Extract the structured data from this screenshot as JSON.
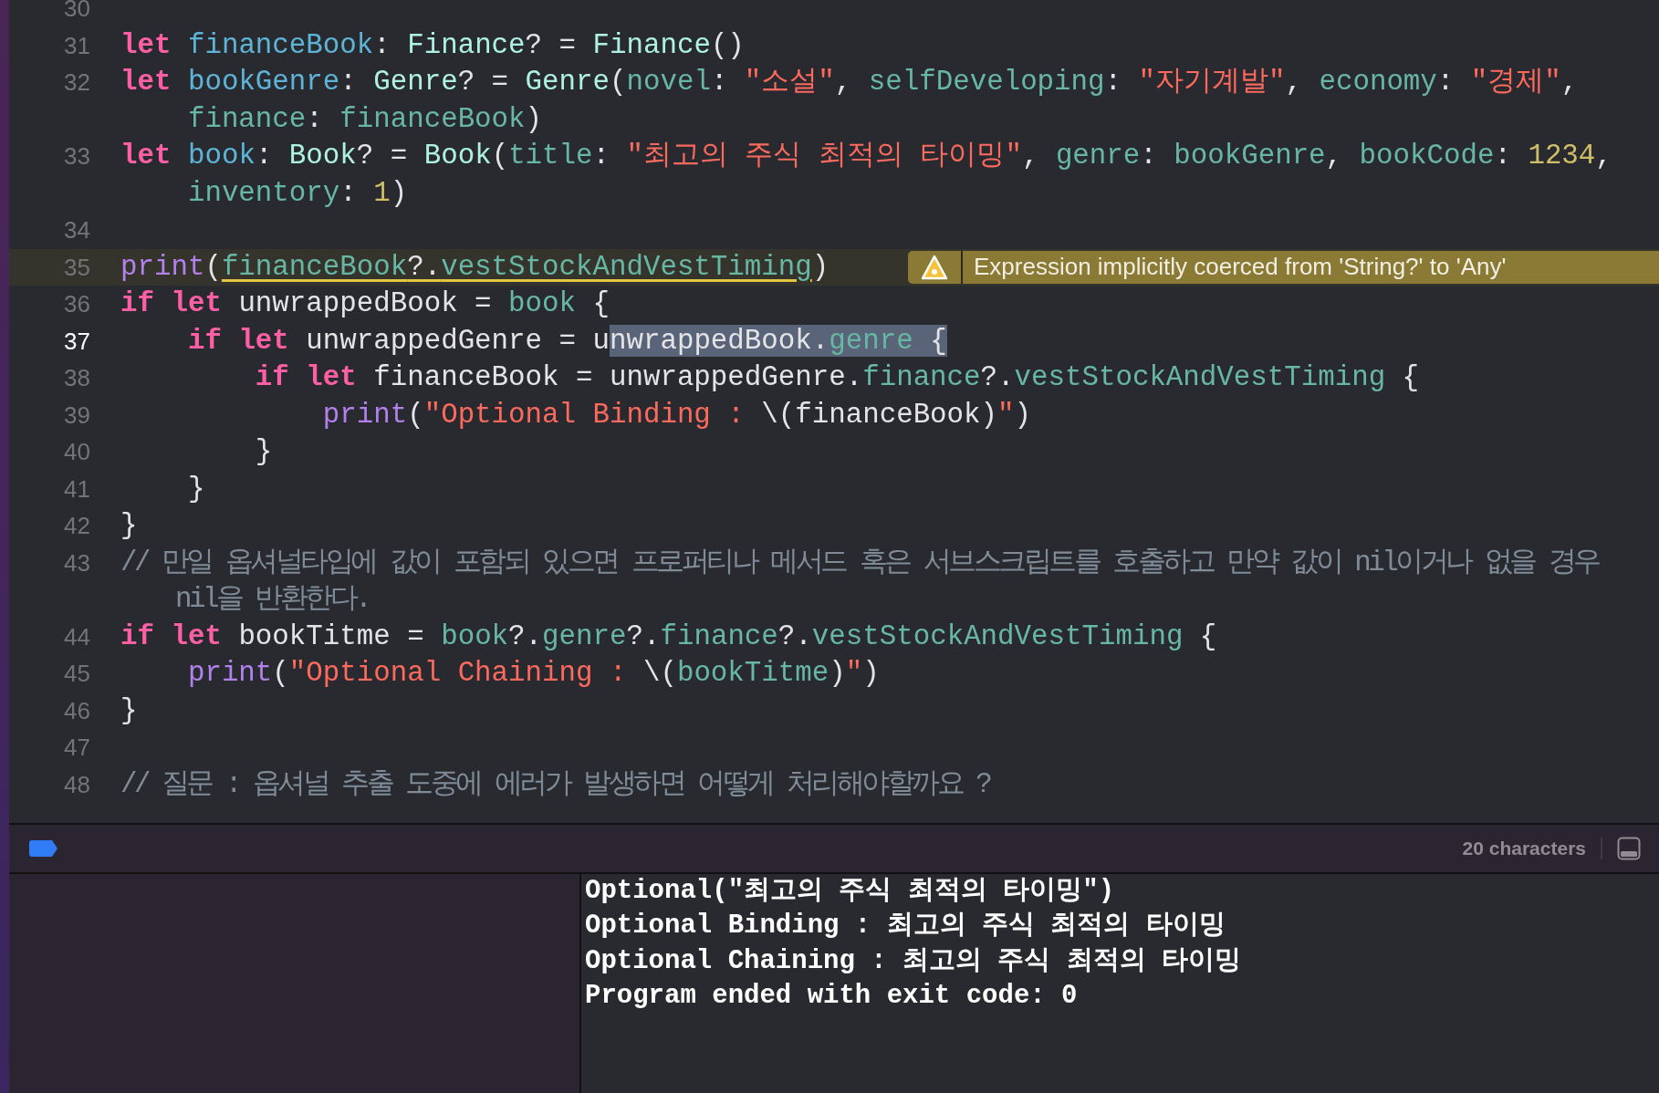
{
  "editor": {
    "lines": [
      {
        "number": "30",
        "active": false
      },
      {
        "number": "31",
        "active": false,
        "tokens": [
          {
            "text": "let ",
            "kind": "keyword"
          },
          {
            "text": "financeBook",
            "kind": "decl"
          },
          {
            "text": ": ",
            "kind": "plain"
          },
          {
            "text": "Finance",
            "kind": "type"
          },
          {
            "text": "? = ",
            "kind": "plain"
          },
          {
            "text": "Finance",
            "kind": "type"
          },
          {
            "text": "()",
            "kind": "plain"
          }
        ]
      },
      {
        "number": "32",
        "active": false,
        "tokens": [
          {
            "text": "let ",
            "kind": "keyword"
          },
          {
            "text": "bookGenre",
            "kind": "decl"
          },
          {
            "text": ": ",
            "kind": "plain"
          },
          {
            "text": "Genre",
            "kind": "type"
          },
          {
            "text": "? = ",
            "kind": "plain"
          },
          {
            "text": "Genre",
            "kind": "type"
          },
          {
            "text": "(",
            "kind": "plain"
          },
          {
            "text": "novel",
            "kind": "member"
          },
          {
            "text": ": ",
            "kind": "plain"
          },
          {
            "text": "\"소설\"",
            "kind": "string"
          },
          {
            "text": ", ",
            "kind": "plain"
          },
          {
            "text": "selfDeveloping",
            "kind": "member"
          },
          {
            "text": ": ",
            "kind": "plain"
          },
          {
            "text": "\"자기계발\"",
            "kind": "string"
          },
          {
            "text": ", ",
            "kind": "plain"
          },
          {
            "text": "economy",
            "kind": "member"
          },
          {
            "text": ": ",
            "kind": "plain"
          },
          {
            "text": "\"경제\"",
            "kind": "string"
          },
          {
            "text": ",",
            "kind": "plain"
          }
        ],
        "continuation": [
          {
            "text": "    finance",
            "kind": "member"
          },
          {
            "text": ": ",
            "kind": "plain"
          },
          {
            "text": "financeBook",
            "kind": "member"
          },
          {
            "text": ")",
            "kind": "plain"
          }
        ]
      },
      {
        "number": "33",
        "active": false,
        "tokens": [
          {
            "text": "let ",
            "kind": "keyword"
          },
          {
            "text": "book",
            "kind": "decl"
          },
          {
            "text": ": ",
            "kind": "plain"
          },
          {
            "text": "Book",
            "kind": "type"
          },
          {
            "text": "? = ",
            "kind": "plain"
          },
          {
            "text": "Book",
            "kind": "type"
          },
          {
            "text": "(",
            "kind": "plain"
          },
          {
            "text": "title",
            "kind": "member"
          },
          {
            "text": ": ",
            "kind": "plain"
          },
          {
            "text": "\"최고의 주식 최적의 타이밍\"",
            "kind": "string"
          },
          {
            "text": ", ",
            "kind": "plain"
          },
          {
            "text": "genre",
            "kind": "member"
          },
          {
            "text": ": ",
            "kind": "plain"
          },
          {
            "text": "bookGenre",
            "kind": "member"
          },
          {
            "text": ", ",
            "kind": "plain"
          },
          {
            "text": "bookCode",
            "kind": "member"
          },
          {
            "text": ": ",
            "kind": "plain"
          },
          {
            "text": "1234",
            "kind": "number"
          },
          {
            "text": ",",
            "kind": "plain"
          }
        ],
        "continuation": [
          {
            "text": "    inventory",
            "kind": "member"
          },
          {
            "text": ": ",
            "kind": "plain"
          },
          {
            "text": "1",
            "kind": "number"
          },
          {
            "text": ")",
            "kind": "plain"
          }
        ]
      },
      {
        "number": "34",
        "active": false
      },
      {
        "number": "35",
        "active": false,
        "warning": "Expression implicitly coerced from 'String?' to 'Any'",
        "tokens": [
          {
            "text": "print",
            "kind": "function"
          },
          {
            "text": "(",
            "kind": "plain"
          },
          {
            "text": "financeBook",
            "kind": "member",
            "underlined": true
          },
          {
            "text": "?.",
            "kind": "plain",
            "underlined": true
          },
          {
            "text": "vestStockAndVestTiming",
            "kind": "member",
            "underlined": true
          },
          {
            "text": ")",
            "kind": "plain"
          }
        ]
      },
      {
        "number": "36",
        "active": false,
        "tokens": [
          {
            "text": "if ",
            "kind": "keyword"
          },
          {
            "text": "let",
            "kind": "keyword"
          },
          {
            "text": " unwrappedBook = ",
            "kind": "plain"
          },
          {
            "text": "book",
            "kind": "member"
          },
          {
            "text": " {",
            "kind": "plain"
          }
        ]
      },
      {
        "number": "37",
        "active": true,
        "tokens": [
          {
            "text": "    if ",
            "kind": "keyword"
          },
          {
            "text": "let",
            "kind": "keyword"
          },
          {
            "text": " unwrappedGenre = u",
            "kind": "plain"
          },
          {
            "text": "nwrappedBook.",
            "kind": "plain",
            "selected": true
          },
          {
            "text": "genre",
            "kind": "member",
            "selected": true
          },
          {
            "text": " {",
            "kind": "plain",
            "selected": true
          }
        ]
      },
      {
        "number": "38",
        "active": false,
        "tokens": [
          {
            "text": "        if ",
            "kind": "keyword"
          },
          {
            "text": "let",
            "kind": "keyword"
          },
          {
            "text": " financeBook = unwrappedGenre.",
            "kind": "plain"
          },
          {
            "text": "finance",
            "kind": "member"
          },
          {
            "text": "?.",
            "kind": "plain"
          },
          {
            "text": "vestStockAndVestTiming",
            "kind": "member"
          },
          {
            "text": " {",
            "kind": "plain"
          }
        ]
      },
      {
        "number": "39",
        "active": false,
        "tokens": [
          {
            "text": "            print",
            "kind": "function"
          },
          {
            "text": "(",
            "kind": "plain"
          },
          {
            "text": "\"Optional Binding : ",
            "kind": "string"
          },
          {
            "text": "\\(financeBook)",
            "kind": "plain"
          },
          {
            "text": "\"",
            "kind": "string"
          },
          {
            "text": ")",
            "kind": "plain"
          }
        ]
      },
      {
        "number": "40",
        "active": false,
        "tokens": [
          {
            "text": "        }",
            "kind": "plain"
          }
        ]
      },
      {
        "number": "41",
        "active": false,
        "tokens": [
          {
            "text": "    }",
            "kind": "plain"
          }
        ]
      },
      {
        "number": "42",
        "active": false,
        "tokens": [
          {
            "text": "}",
            "kind": "plain"
          }
        ]
      },
      {
        "number": "43",
        "active": false,
        "tokens": [
          {
            "text": "// 만일 옵셔널타입에 값이 포함되 있으면 프로퍼티나 메서드 혹은 서브스크립트를 호출하고 만약 값이 nil이거나 없을 경우",
            "kind": "comment"
          }
        ],
        "continuation": [
          {
            "text": "    nil을 반환한다.",
            "kind": "comment"
          }
        ]
      },
      {
        "number": "44",
        "active": false,
        "tokens": [
          {
            "text": "if ",
            "kind": "keyword"
          },
          {
            "text": "let",
            "kind": "keyword"
          },
          {
            "text": " bookTitme = ",
            "kind": "plain"
          },
          {
            "text": "book",
            "kind": "member"
          },
          {
            "text": "?.",
            "kind": "plain"
          },
          {
            "text": "genre",
            "kind": "member"
          },
          {
            "text": "?.",
            "kind": "plain"
          },
          {
            "text": "finance",
            "kind": "member"
          },
          {
            "text": "?.",
            "kind": "plain"
          },
          {
            "text": "vestStockAndVestTiming",
            "kind": "member"
          },
          {
            "text": " {",
            "kind": "plain"
          }
        ]
      },
      {
        "number": "45",
        "active": false,
        "tokens": [
          {
            "text": "    print",
            "kind": "function"
          },
          {
            "text": "(",
            "kind": "plain"
          },
          {
            "text": "\"Optional Chaining : ",
            "kind": "string"
          },
          {
            "text": "\\(",
            "kind": "plain"
          },
          {
            "text": "bookTitme",
            "kind": "member"
          },
          {
            "text": ")",
            "kind": "plain"
          },
          {
            "text": "\"",
            "kind": "string"
          },
          {
            "text": ")",
            "kind": "plain"
          }
        ]
      },
      {
        "number": "46",
        "active": false,
        "tokens": [
          {
            "text": "}",
            "kind": "plain"
          }
        ]
      },
      {
        "number": "47",
        "active": false
      },
      {
        "number": "48",
        "active": false,
        "tokens": [
          {
            "text": "// 질문 : 옵셔널 추출 도중에 에러가 발생하면 어떻게 처리해야할까요 ?",
            "kind": "comment"
          }
        ]
      }
    ]
  },
  "debug_bar": {
    "selection_count": "20 characters"
  },
  "console": {
    "output": [
      "Optional(\"최고의 주식 최적의 타이밍\")",
      "Optional Binding : 최고의 주식 최적의 타이밍",
      "Optional Chaining : 최고의 주식 최적의 타이밍",
      "Program ended with exit code: 0"
    ]
  }
}
